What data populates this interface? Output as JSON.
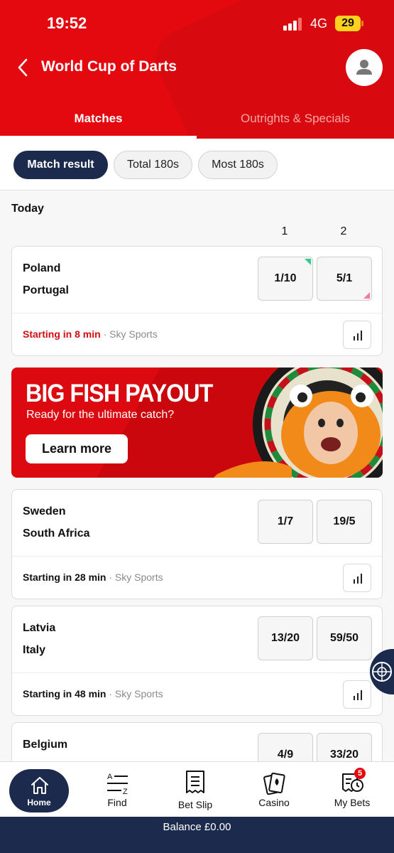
{
  "status": {
    "time": "19:52",
    "network": "4G",
    "battery": "29"
  },
  "header": {
    "title": "World Cup of Darts"
  },
  "tabs": [
    {
      "label": "Matches",
      "active": true
    },
    {
      "label": "Outrights & Specials",
      "active": false
    }
  ],
  "filters": [
    {
      "label": "Match result",
      "active": true
    },
    {
      "label": "Total 180s",
      "active": false
    },
    {
      "label": "Most 180s",
      "active": false
    }
  ],
  "section": {
    "day": "Today",
    "col1": "1",
    "col2": "2"
  },
  "matches": [
    {
      "team1": "Poland",
      "team2": "Portugal",
      "odd1": "1/10",
      "odd2": "5/1",
      "start": "Starting in 8 min",
      "channel": " · Sky Sports"
    },
    {
      "team1": "Sweden",
      "team2": "South Africa",
      "odd1": "1/7",
      "odd2": "19/5",
      "start": "Starting in 28 min",
      "channel": " · Sky Sports"
    },
    {
      "team1": "Latvia",
      "team2": "Italy",
      "odd1": "13/20",
      "odd2": "59/50",
      "start": "Starting in 48 min",
      "channel": " · Sky Sports"
    },
    {
      "team1": "Belgium",
      "odd1": "4/9",
      "odd2": "33/20"
    }
  ],
  "promo": {
    "title": "BIG FISH PAYOUT",
    "subtitle": "Ready for the ultimate catch?",
    "button": "Learn more"
  },
  "nav": {
    "home": "Home",
    "find": "Find",
    "betslip": "Bet Slip",
    "casino": "Casino",
    "mybets": "My Bets",
    "mybets_badge": "5"
  },
  "balance": "Balance £0.00",
  "colors": {
    "brand_red": "#e3090e",
    "navy": "#1c2b4d"
  }
}
